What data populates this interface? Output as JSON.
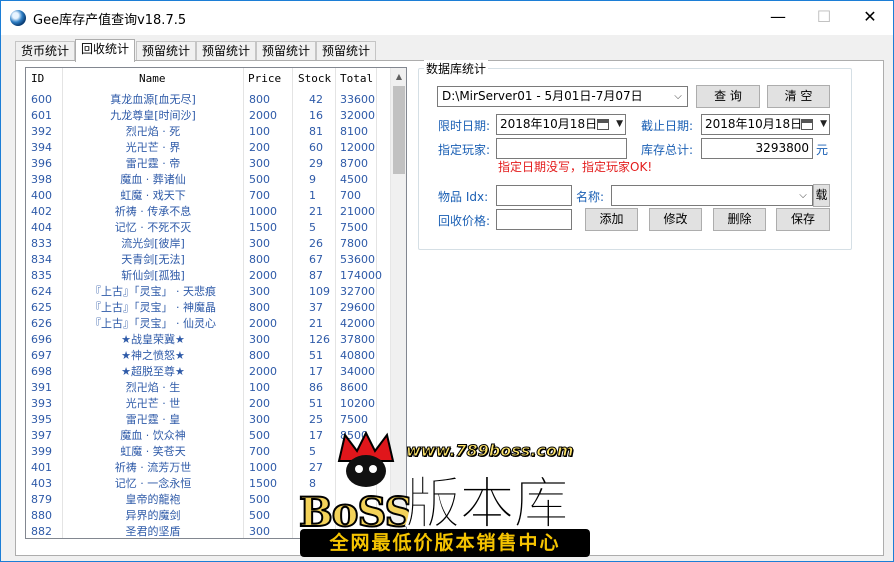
{
  "window": {
    "title": "Gee库存产值查询v18.7.5",
    "minimize_glyph": "—",
    "maximize_glyph": "☐",
    "close_glyph": "✕"
  },
  "tabs": [
    {
      "label": "货币统计"
    },
    {
      "label": "回收统计"
    },
    {
      "label": "预留统计"
    },
    {
      "label": "预留统计"
    },
    {
      "label": "预留统计"
    },
    {
      "label": "预留统计"
    }
  ],
  "table": {
    "headers": [
      "ID",
      "Name",
      "Price",
      "Stock",
      "Total"
    ],
    "rows": [
      [
        "600",
        "真龙血源[血无尽]",
        "800",
        "42",
        "33600"
      ],
      [
        "601",
        "九龙尊皇[时间沙]",
        "2000",
        "16",
        "32000"
      ],
      [
        "392",
        "烈卍焰 · 死",
        "100",
        "81",
        "8100"
      ],
      [
        "394",
        "光卍芒 · 界",
        "200",
        "60",
        "12000"
      ],
      [
        "396",
        "雷卍霆 · 帝",
        "300",
        "29",
        "8700"
      ],
      [
        "398",
        "魔血 · 葬诸仙",
        "500",
        "9",
        "4500"
      ],
      [
        "400",
        "虹魔 · 戏天下",
        "700",
        "1",
        "700"
      ],
      [
        "402",
        "祈祷 · 传承不息",
        "1000",
        "21",
        "21000"
      ],
      [
        "404",
        "记忆 · 不死不灭",
        "1500",
        "5",
        "7500"
      ],
      [
        "833",
        "流光剑[彼岸]",
        "300",
        "26",
        "7800"
      ],
      [
        "834",
        "天青剑[无法]",
        "800",
        "67",
        "53600"
      ],
      [
        "835",
        "斩仙剑[孤独]",
        "2000",
        "87",
        "174000"
      ],
      [
        "624",
        "『上古』「灵宝」 · 天悲痕",
        "300",
        "109",
        "32700"
      ],
      [
        "625",
        "『上古』「灵宝」 · 神魔晶",
        "800",
        "37",
        "29600"
      ],
      [
        "626",
        "『上古』「灵宝」 · 仙灵心",
        "2000",
        "21",
        "42000"
      ],
      [
        "696",
        "★战皇荣冀★",
        "300",
        "126",
        "37800"
      ],
      [
        "697",
        "★神之愤怒★",
        "800",
        "51",
        "40800"
      ],
      [
        "698",
        "★超脱至尊★",
        "2000",
        "17",
        "34000"
      ],
      [
        "391",
        "烈卍焰 · 生",
        "100",
        "86",
        "8600"
      ],
      [
        "393",
        "光卍芒 · 世",
        "200",
        "51",
        "10200"
      ],
      [
        "395",
        "雷卍霆 · 皇",
        "300",
        "25",
        "7500"
      ],
      [
        "397",
        "魔血 · 饮众神",
        "500",
        "17",
        "8500"
      ],
      [
        "399",
        "虹魔 · 笑苍天",
        "700",
        "5",
        ""
      ],
      [
        "401",
        "祈祷 · 流芳万世",
        "1000",
        "27",
        ""
      ],
      [
        "403",
        "记忆 · 一念永恒",
        "1500",
        "8",
        ""
      ],
      [
        "879",
        "皇帝的龍袍",
        "500",
        "",
        ""
      ],
      [
        "880",
        "异界的魔剑",
        "500",
        "",
        ""
      ],
      [
        "882",
        "圣君的坚盾",
        "300",
        "",
        ""
      ]
    ]
  },
  "db_stats": {
    "legend": "数据库统计",
    "server_select": "D:\\MirServer01 - 5月01日-7月07日",
    "query_button": "查 询",
    "clear_button": "清 空",
    "start_date_label": "限时日期:",
    "start_date": "2018年10月18日",
    "end_date_label": "截止日期:",
    "end_date": "2018年10月18日",
    "player_label": "指定玩家:",
    "player_value": "",
    "total_label": "库存总计:",
    "total_value": "3293800",
    "total_unit": "元",
    "warning": "指定日期没写，指定玩家OK!",
    "item_idx_label": "物品 Idx:",
    "item_idx_value": "",
    "name_label": "名称:",
    "name_value": "",
    "load_button": "载",
    "recycle_price_label": "回收价格:",
    "recycle_price_value": "",
    "add_button": "添加",
    "modify_button": "修改",
    "delete_button": "删除",
    "save_button": "保存"
  },
  "watermark": {
    "url": "www.789boss.com",
    "brand": "BoSS",
    "title": "版本库",
    "slogan": "全网最低价版本销售中心"
  },
  "colors": {
    "accent": "#1a5fb4",
    "table_text": "#2e5aa8",
    "warning": "#e31c1c"
  }
}
